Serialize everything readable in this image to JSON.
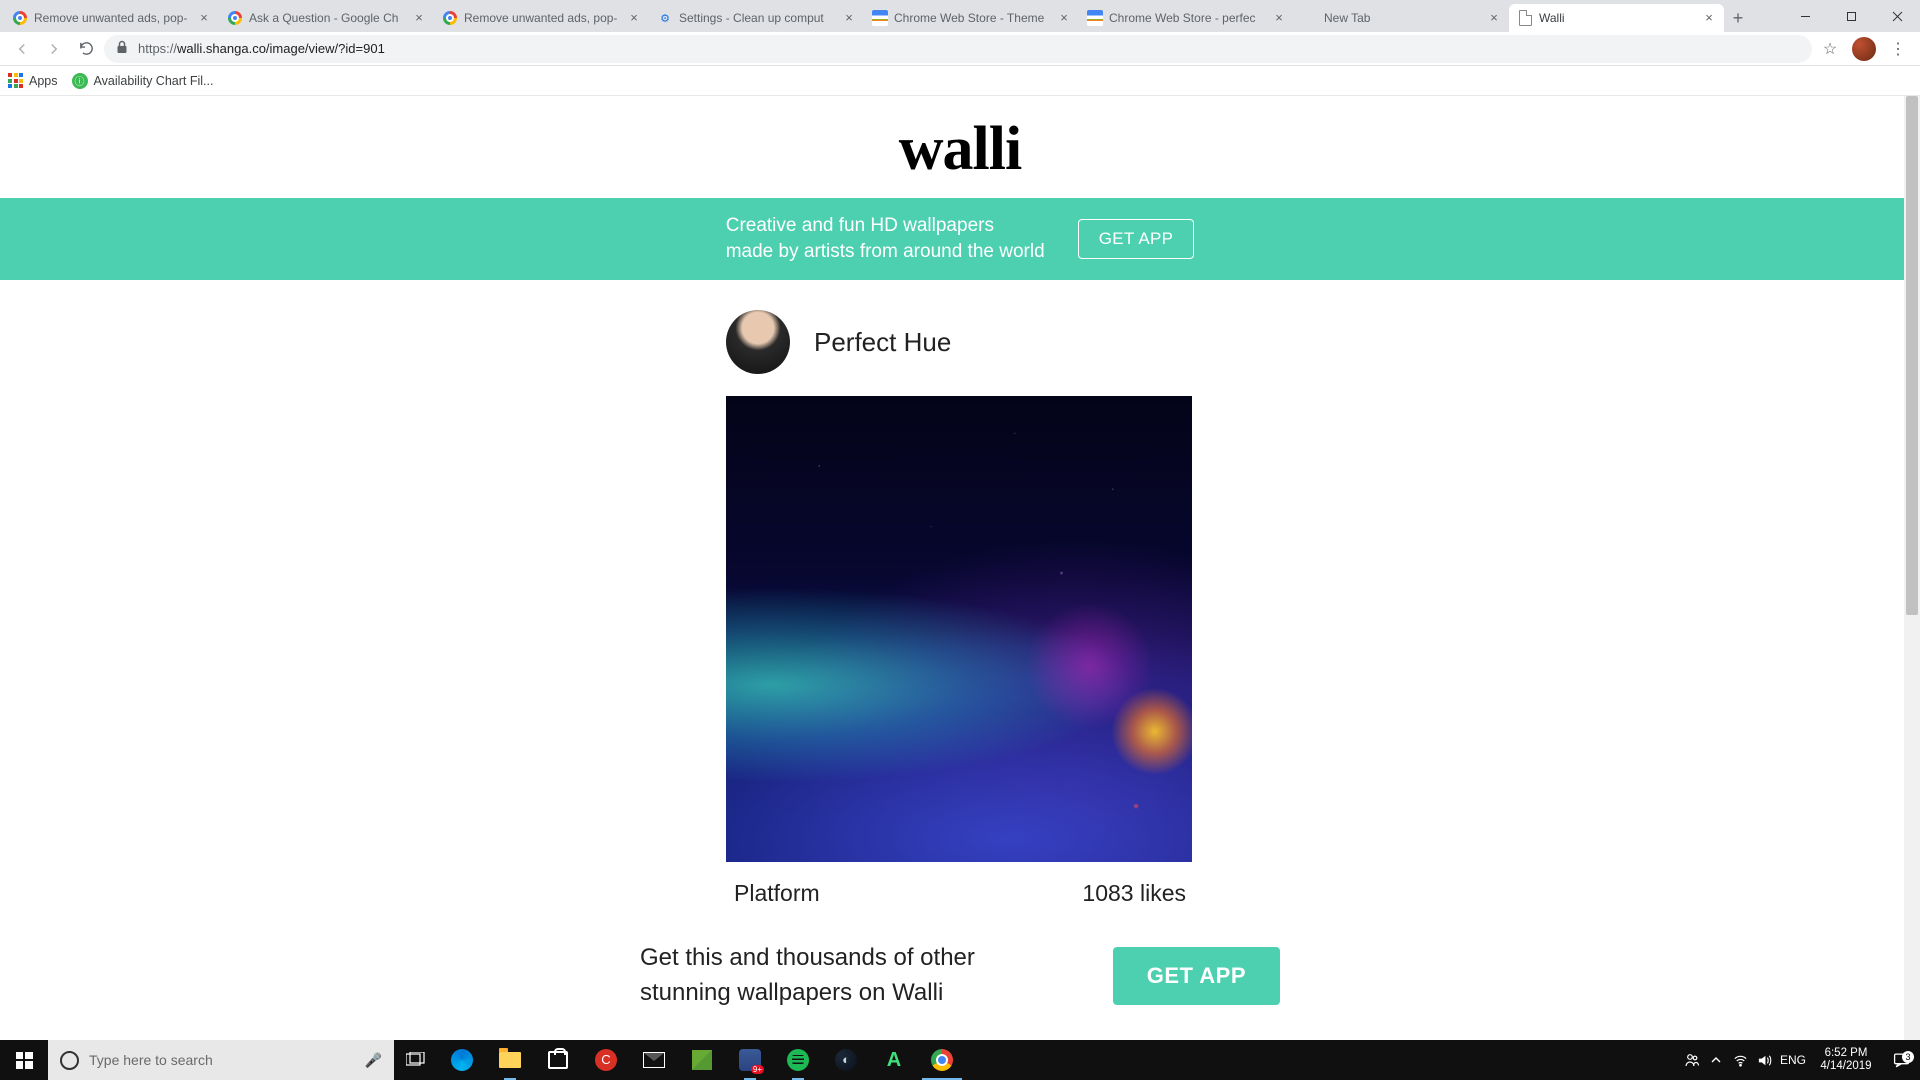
{
  "window": {
    "minimize": "–",
    "maximize": "❐",
    "close": "✕"
  },
  "tabs": [
    {
      "title": "Remove unwanted ads, pop-",
      "fav": "g"
    },
    {
      "title": "Ask a Question - Google Ch",
      "fav": "g"
    },
    {
      "title": "Remove unwanted ads, pop-",
      "fav": "g"
    },
    {
      "title": "Settings - Clean up comput",
      "fav": "gear"
    },
    {
      "title": "Chrome Web Store - Theme",
      "fav": "cws"
    },
    {
      "title": "Chrome Web Store - perfec",
      "fav": "cws"
    },
    {
      "title": "New Tab",
      "fav": ""
    },
    {
      "title": "Walli",
      "fav": "page",
      "active": true
    }
  ],
  "newtab_plus": "+",
  "nav": {
    "back": "←",
    "forward": "→",
    "reload": "⟳"
  },
  "url_proto": "https://",
  "url_rest": "walli.shanga.co/image/view/?id=901",
  "star": "☆",
  "kebab": "⋮",
  "bookmarks": {
    "apps": "Apps",
    "item1": "Availability Chart Fil..."
  },
  "page": {
    "logo": "walli",
    "promo_text": "Creative and fun HD wallpapers made by artists from around the world",
    "get_app": "GET APP",
    "author": "Perfect Hue",
    "title": "Platform",
    "likes": "1083 likes",
    "cta_text": "Get this and thousands of other stunning wallpapers on Walli",
    "cta_btn": "GET APP"
  },
  "taskbar": {
    "search_placeholder": "Type here to search",
    "lang": "ENG",
    "time": "6:52 PM",
    "date": "4/14/2019",
    "notif_count": "3"
  }
}
